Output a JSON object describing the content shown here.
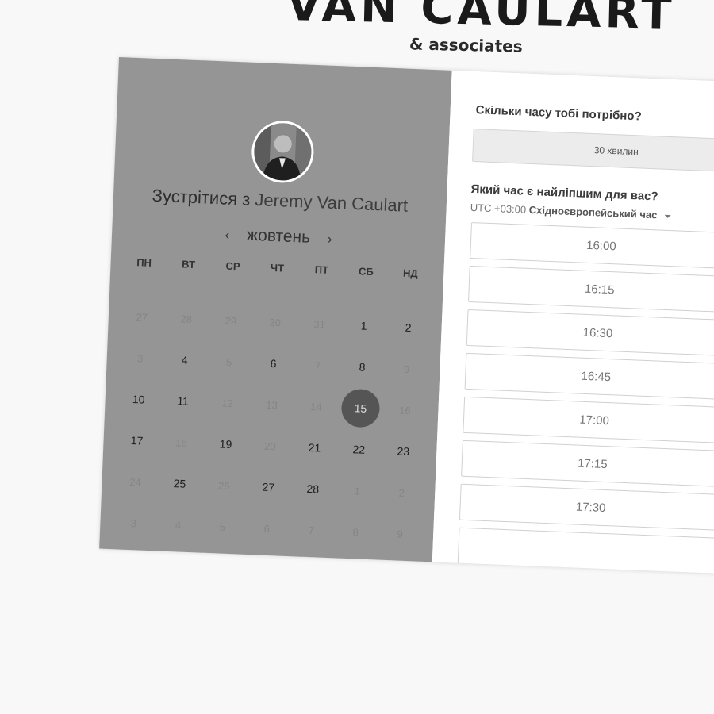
{
  "brand": {
    "name": "VAN CAULART",
    "tagline": "& associates"
  },
  "host": {
    "intro": "Зустрітися з",
    "name": "Jeremy Van Caulart"
  },
  "calendar": {
    "month": "жовтень",
    "prev_icon": "chevron-left-icon",
    "next_icon": "chevron-right-icon",
    "weekdays": [
      "ПН",
      "ВТ",
      "СР",
      "ЧТ",
      "ПТ",
      "СБ",
      "НД"
    ],
    "days": [
      {
        "label": "27",
        "state": "out"
      },
      {
        "label": "28",
        "state": "out"
      },
      {
        "label": "29",
        "state": "out"
      },
      {
        "label": "30",
        "state": "out"
      },
      {
        "label": "31",
        "state": "out"
      },
      {
        "label": "1",
        "state": "available"
      },
      {
        "label": "2",
        "state": "available"
      },
      {
        "label": "3",
        "state": "unavailable"
      },
      {
        "label": "4",
        "state": "available"
      },
      {
        "label": "5",
        "state": "unavailable"
      },
      {
        "label": "6",
        "state": "available"
      },
      {
        "label": "7",
        "state": "unavailable"
      },
      {
        "label": "8",
        "state": "available"
      },
      {
        "label": "9",
        "state": "unavailable"
      },
      {
        "label": "10",
        "state": "available"
      },
      {
        "label": "11",
        "state": "available"
      },
      {
        "label": "12",
        "state": "unavailable"
      },
      {
        "label": "13",
        "state": "unavailable"
      },
      {
        "label": "14",
        "state": "unavailable"
      },
      {
        "label": "15",
        "state": "selected"
      },
      {
        "label": "16",
        "state": "unavailable"
      },
      {
        "label": "17",
        "state": "available"
      },
      {
        "label": "18",
        "state": "unavailable"
      },
      {
        "label": "19",
        "state": "available"
      },
      {
        "label": "20",
        "state": "unavailable"
      },
      {
        "label": "21",
        "state": "available"
      },
      {
        "label": "22",
        "state": "available"
      },
      {
        "label": "23",
        "state": "available"
      },
      {
        "label": "24",
        "state": "unavailable"
      },
      {
        "label": "25",
        "state": "available"
      },
      {
        "label": "26",
        "state": "unavailable"
      },
      {
        "label": "27",
        "state": "available"
      },
      {
        "label": "28",
        "state": "available"
      },
      {
        "label": "1",
        "state": "out"
      },
      {
        "label": "2",
        "state": "out"
      },
      {
        "label": "3",
        "state": "out"
      },
      {
        "label": "4",
        "state": "out"
      },
      {
        "label": "5",
        "state": "out"
      },
      {
        "label": "6",
        "state": "out"
      },
      {
        "label": "7",
        "state": "out"
      },
      {
        "label": "8",
        "state": "out"
      },
      {
        "label": "9",
        "state": "out"
      }
    ]
  },
  "booking": {
    "duration_question": "Скільки часу тобі потрібно?",
    "duration_value": "30 хвилин",
    "time_question": "Який час є найліпшим для вас?",
    "timezone_offset": "UTC +03:00",
    "timezone_name": "Східноєвропейський час",
    "slots": [
      "16:00",
      "16:15",
      "16:30",
      "16:45",
      "17:00",
      "17:15",
      "17:30"
    ]
  }
}
